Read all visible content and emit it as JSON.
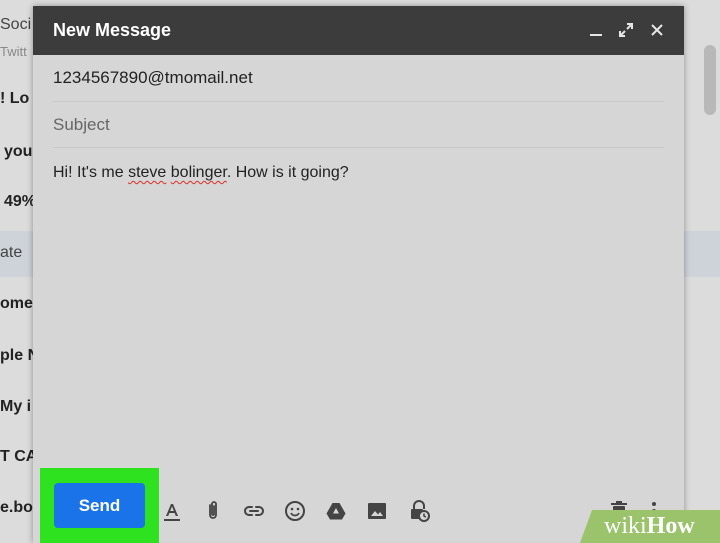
{
  "background_inbox": {
    "rows": [
      {
        "text": "Soci",
        "style": "light"
      },
      {
        "text": "Twitt",
        "style": "sub"
      },
      {
        "text": "! Lo",
        "style": "bold"
      },
      {
        "text": "you",
        "style": "bold"
      },
      {
        "text": "49%",
        "style": "bold"
      },
      {
        "text": "ate",
        "style": "light"
      },
      {
        "text": "ome",
        "style": "bold"
      },
      {
        "text": "ple N",
        "style": "bold"
      },
      {
        "text": "My i",
        "style": "bold"
      },
      {
        "text": "T CA",
        "style": "bold"
      },
      {
        "text": "e.bol",
        "style": "bold"
      }
    ]
  },
  "compose": {
    "title": "New Message",
    "to": "1234567890@tmomail.net",
    "subject_placeholder": "Subject",
    "body_parts": {
      "before": "Hi! It's me ",
      "misspelled1": "steve",
      "space": " ",
      "misspelled2": "bolinger",
      "after": ". How is it going?"
    },
    "send_label": "Send",
    "header_icons": [
      "minimize-icon",
      "expand-icon",
      "close-icon"
    ],
    "toolbar_icons": [
      "formatting-icon",
      "attach-icon",
      "link-icon",
      "emoji-icon",
      "drive-icon",
      "photo-icon",
      "confidential-icon",
      "delete-icon",
      "more-options-icon"
    ]
  },
  "colors": {
    "header_bg": "#3c3c3c",
    "send_bg": "#1a73e8",
    "highlight": "#2ee21f"
  },
  "watermark": {
    "brand_prefix": "wiki",
    "brand_suffix": "How"
  }
}
